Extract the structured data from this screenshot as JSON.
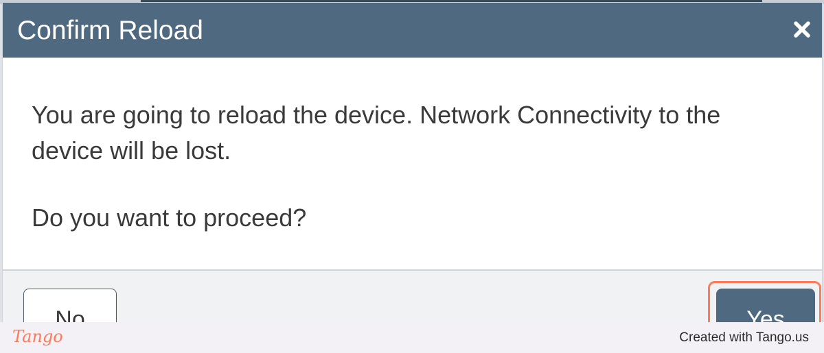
{
  "dialog": {
    "title": "Confirm Reload",
    "message": "You are going to reload the device. Network Connectivity to the device will be lost.",
    "question": "Do you want to proceed?",
    "buttons": {
      "no_label": "No",
      "yes_label": "Yes"
    },
    "close_icon": "close-icon"
  },
  "watermark": {
    "logo_text": "Tango",
    "credit_text": "Created with Tango.us"
  },
  "colors": {
    "header_bg": "#4f6a80",
    "primary_button": "#4f6a80",
    "highlight": "#ff7a59",
    "footer_bg": "#f1f2f4"
  }
}
